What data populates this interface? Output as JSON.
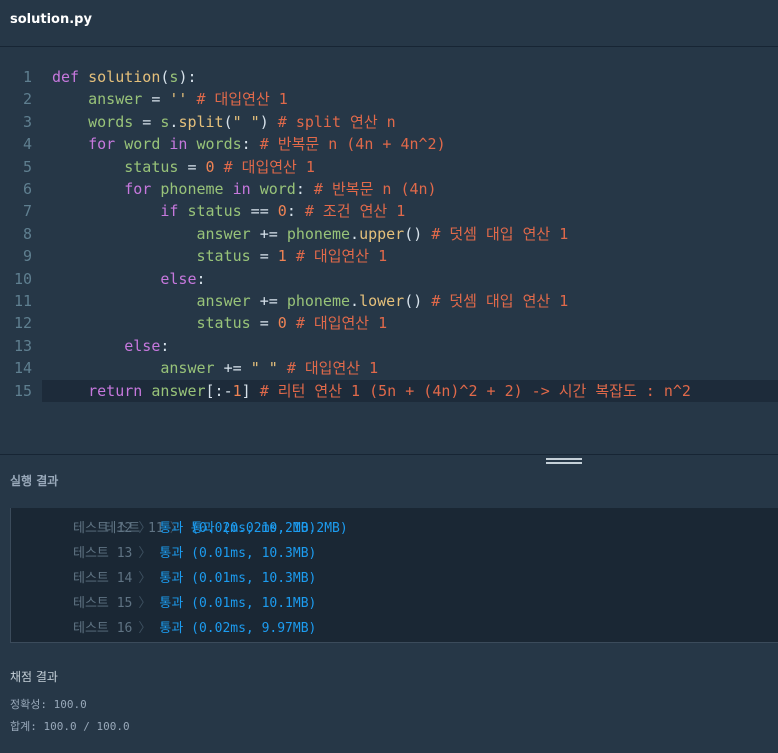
{
  "tab": {
    "title": "solution.py"
  },
  "code": {
    "line_numbers": [
      "1",
      "2",
      "3",
      "4",
      "5",
      "6",
      "7",
      "8",
      "9",
      "10",
      "11",
      "12",
      "13",
      "14",
      "15"
    ],
    "lines": [
      [
        [
          "kw",
          "def "
        ],
        [
          "fn",
          "solution"
        ],
        [
          "pl",
          "("
        ],
        [
          "var",
          "s"
        ],
        [
          "pl",
          "):"
        ]
      ],
      [
        [
          "pl",
          "    "
        ],
        [
          "var",
          "answer"
        ],
        [
          "pl",
          " = "
        ],
        [
          "str",
          "''"
        ],
        [
          "pl",
          " "
        ],
        [
          "cm",
          "# 대입연산 1"
        ]
      ],
      [
        [
          "pl",
          "    "
        ],
        [
          "var",
          "words"
        ],
        [
          "pl",
          " = "
        ],
        [
          "var",
          "s"
        ],
        [
          "pl",
          "."
        ],
        [
          "fn",
          "split"
        ],
        [
          "pl",
          "("
        ],
        [
          "str",
          "\" \""
        ],
        [
          "pl",
          ") "
        ],
        [
          "cm",
          "# split 연산 n"
        ]
      ],
      [
        [
          "pl",
          "    "
        ],
        [
          "kw",
          "for"
        ],
        [
          "pl",
          " "
        ],
        [
          "var",
          "word"
        ],
        [
          "pl",
          " "
        ],
        [
          "kw",
          "in"
        ],
        [
          "pl",
          " "
        ],
        [
          "var",
          "words"
        ],
        [
          "pl",
          ": "
        ],
        [
          "cm",
          "# 반복문 n (4n + 4n^2)"
        ]
      ],
      [
        [
          "pl",
          "        "
        ],
        [
          "var",
          "status"
        ],
        [
          "pl",
          " = "
        ],
        [
          "num",
          "0"
        ],
        [
          "pl",
          " "
        ],
        [
          "cm",
          "# 대입연산 1"
        ]
      ],
      [
        [
          "pl",
          "        "
        ],
        [
          "kw",
          "for"
        ],
        [
          "pl",
          " "
        ],
        [
          "var",
          "phoneme"
        ],
        [
          "pl",
          " "
        ],
        [
          "kw",
          "in"
        ],
        [
          "pl",
          " "
        ],
        [
          "var",
          "word"
        ],
        [
          "pl",
          ": "
        ],
        [
          "cm",
          "# 반복문 n (4n)"
        ]
      ],
      [
        [
          "pl",
          "            "
        ],
        [
          "kw",
          "if"
        ],
        [
          "pl",
          " "
        ],
        [
          "var",
          "status"
        ],
        [
          "pl",
          " == "
        ],
        [
          "num",
          "0"
        ],
        [
          "pl",
          ": "
        ],
        [
          "cm",
          "# 조건 연산 1"
        ]
      ],
      [
        [
          "pl",
          "                "
        ],
        [
          "var",
          "answer"
        ],
        [
          "pl",
          " += "
        ],
        [
          "var",
          "phoneme"
        ],
        [
          "pl",
          "."
        ],
        [
          "fn",
          "upper"
        ],
        [
          "pl",
          "() "
        ],
        [
          "cm",
          "# 덧셈 대입 연산 1"
        ]
      ],
      [
        [
          "pl",
          "                "
        ],
        [
          "var",
          "status"
        ],
        [
          "pl",
          " = "
        ],
        [
          "num",
          "1"
        ],
        [
          "pl",
          " "
        ],
        [
          "cm",
          "# 대입연산 1"
        ]
      ],
      [
        [
          "pl",
          "            "
        ],
        [
          "kw",
          "else"
        ],
        [
          "pl",
          ":"
        ]
      ],
      [
        [
          "pl",
          "                "
        ],
        [
          "var",
          "answer"
        ],
        [
          "pl",
          " += "
        ],
        [
          "var",
          "phoneme"
        ],
        [
          "pl",
          "."
        ],
        [
          "fn",
          "lower"
        ],
        [
          "pl",
          "() "
        ],
        [
          "cm",
          "# 덧셈 대입 연산 1"
        ]
      ],
      [
        [
          "pl",
          "                "
        ],
        [
          "var",
          "status"
        ],
        [
          "pl",
          " = "
        ],
        [
          "num",
          "0"
        ],
        [
          "pl",
          " "
        ],
        [
          "cm",
          "# 대입연산 1"
        ]
      ],
      [
        [
          "pl",
          "        "
        ],
        [
          "kw",
          "else"
        ],
        [
          "pl",
          ":"
        ]
      ],
      [
        [
          "pl",
          "            "
        ],
        [
          "var",
          "answer"
        ],
        [
          "pl",
          " += "
        ],
        [
          "str",
          "\" \""
        ],
        [
          "pl",
          " "
        ],
        [
          "cm",
          "# 대입연산 1"
        ]
      ],
      [
        [
          "pl",
          "    "
        ],
        [
          "kw",
          "return"
        ],
        [
          "pl",
          " "
        ],
        [
          "var",
          "answer"
        ],
        [
          "pl",
          "[:-"
        ],
        [
          "num",
          "1"
        ],
        [
          "pl",
          "] "
        ],
        [
          "cm",
          "# 리턴 연산 1 (5n + (4n)^2 + 2) -> 시간 복잡도 : n^2"
        ]
      ]
    ]
  },
  "results": {
    "title": "실행 결과",
    "partial_label": "테스트 11",
    "partial_result": "통과 (0.02ms, 10.2MB)",
    "rows": [
      {
        "label": "테스트 12",
        "result": "통과 (0.02ms, 10.2MB)"
      },
      {
        "label": "테스트 13",
        "result": "통과 (0.01ms, 10.3MB)"
      },
      {
        "label": "테스트 14",
        "result": "통과 (0.01ms, 10.3MB)"
      },
      {
        "label": "테스트 15",
        "result": "통과 (0.01ms, 10.1MB)"
      },
      {
        "label": "테스트 16",
        "result": "통과 (0.02ms, 9.97MB)"
      }
    ]
  },
  "grading": {
    "title": "채점 결과",
    "accuracy": "정확성: 100.0",
    "total": "합계: 100.0 / 100.0"
  },
  "colors": {
    "background": "#263747",
    "keyword": "#c678dd",
    "function": "#e5c07b",
    "variable": "#98c379",
    "comment": "#e0694a",
    "pass": "#1c9cf0"
  }
}
